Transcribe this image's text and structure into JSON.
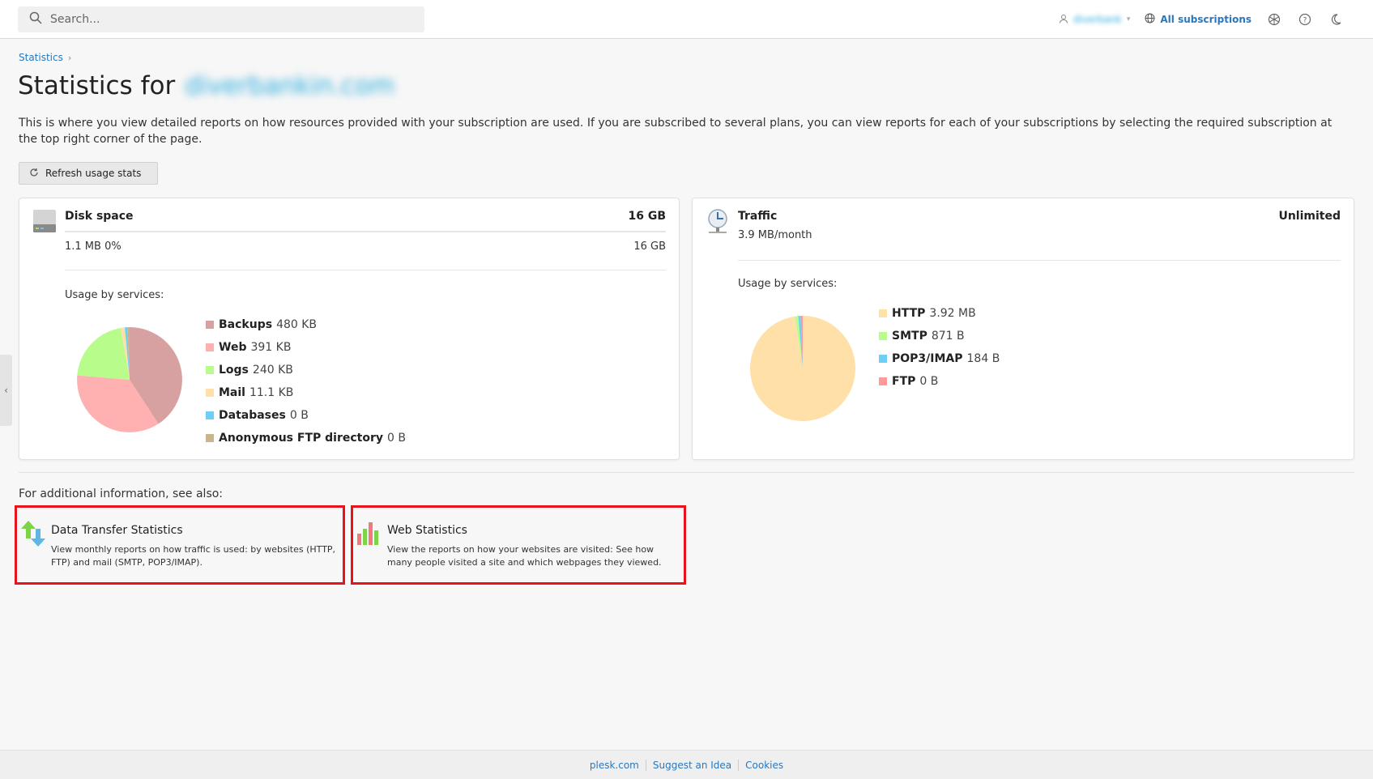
{
  "search": {
    "placeholder": "Search..."
  },
  "header": {
    "user_name": "diverbank",
    "subscriptions_label": "All subscriptions"
  },
  "breadcrumb": {
    "item": "Statistics"
  },
  "page": {
    "title_prefix": "Statistics for",
    "domain": "diverbankin.com",
    "description": "This is where you view detailed reports on how resources provided with your subscription are used. If you are subscribed to several plans, you can view reports for each of your subscriptions by selecting the required subscription at the top right corner of the page.",
    "refresh_label": "Refresh usage stats"
  },
  "disk": {
    "title": "Disk space",
    "limit": "16 GB",
    "used": "1.1 MB 0%",
    "total": "16 GB",
    "usage_label": "Usage by services:",
    "legend": [
      {
        "name": "Backups",
        "value": "480 KB",
        "color": "#d8a1a1"
      },
      {
        "name": "Web",
        "value": "391 KB",
        "color": "#ffb0b0"
      },
      {
        "name": "Logs",
        "value": "240 KB",
        "color": "#b8fc8c"
      },
      {
        "name": "Mail",
        "value": "11.1 KB",
        "color": "#ffe0a8"
      },
      {
        "name": "Databases",
        "value": "0 B",
        "color": "#6ecff6"
      },
      {
        "name": "Anonymous FTP directory",
        "value": "0 B",
        "color": "#c9b58a"
      }
    ]
  },
  "traffic": {
    "title": "Traffic",
    "limit": "Unlimited",
    "used": "3.9 MB/month",
    "usage_label": "Usage by services:",
    "legend": [
      {
        "name": "HTTP",
        "value": "3.92 MB",
        "color": "#ffe0a8"
      },
      {
        "name": "SMTP",
        "value": "871 B",
        "color": "#b8fc8c"
      },
      {
        "name": "POP3/IMAP",
        "value": "184 B",
        "color": "#6ecff6"
      },
      {
        "name": "FTP",
        "value": "0 B",
        "color": "#ff9a9a"
      }
    ]
  },
  "see_also": {
    "label": "For additional information, see also:",
    "links": [
      {
        "title": "Data Transfer Statistics",
        "desc": "View monthly reports on how traffic is used: by websites (HTTP, FTP) and mail (SMTP, POP3/IMAP)."
      },
      {
        "title": "Web Statistics",
        "desc": "View the reports on how your websites are visited: See how many people visited a site and which webpages they viewed."
      }
    ]
  },
  "footer": {
    "links": [
      "plesk.com",
      "Suggest an Idea",
      "Cookies"
    ]
  },
  "colors": {
    "accent": "#2a77bd",
    "highlight": "#e8131b"
  }
}
